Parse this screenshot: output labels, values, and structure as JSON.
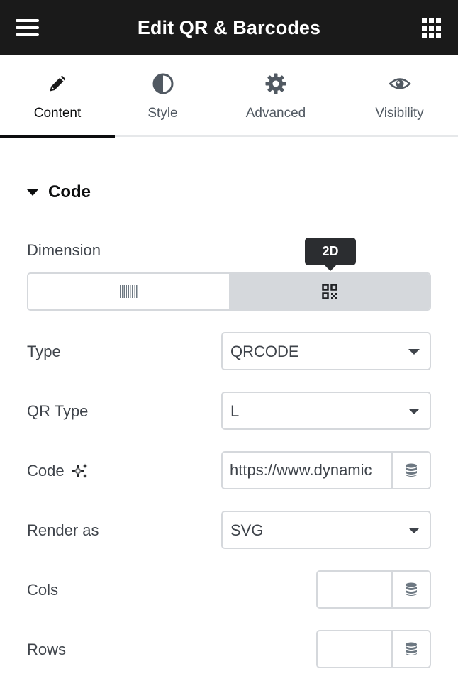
{
  "header": {
    "title": "Edit QR & Barcodes",
    "menu_icon": "hamburger-menu-icon",
    "apps_icon": "grid-icon"
  },
  "tabs": [
    {
      "label": "Content",
      "icon": "pencil-icon",
      "active": true
    },
    {
      "label": "Style",
      "icon": "contrast-icon",
      "active": false
    },
    {
      "label": "Advanced",
      "icon": "gear-icon",
      "active": false
    },
    {
      "label": "Visibility",
      "icon": "eye-icon",
      "active": false
    }
  ],
  "section": {
    "title": "Code"
  },
  "fields": {
    "dimension": {
      "label": "Dimension",
      "tooltip": "2D",
      "options": [
        "barcode-1d-icon",
        "qr-2d-icon"
      ],
      "selected": "2D"
    },
    "type": {
      "label": "Type",
      "value": "QRCODE"
    },
    "qr_type": {
      "label": "QR Type",
      "value": "L"
    },
    "code": {
      "label": "Code",
      "value": "https://www.dynamic",
      "ai_icon": "sparkle-icon",
      "dynamic_icon": "database-icon"
    },
    "render_as": {
      "label": "Render as",
      "value": "SVG"
    },
    "cols": {
      "label": "Cols",
      "value": ""
    },
    "rows": {
      "label": "Rows",
      "value": ""
    }
  },
  "colors": {
    "header_bg": "#1a1a1a",
    "border": "#d5d8dc",
    "active_toggle": "#d5d8dc",
    "text": "#3f444b"
  }
}
